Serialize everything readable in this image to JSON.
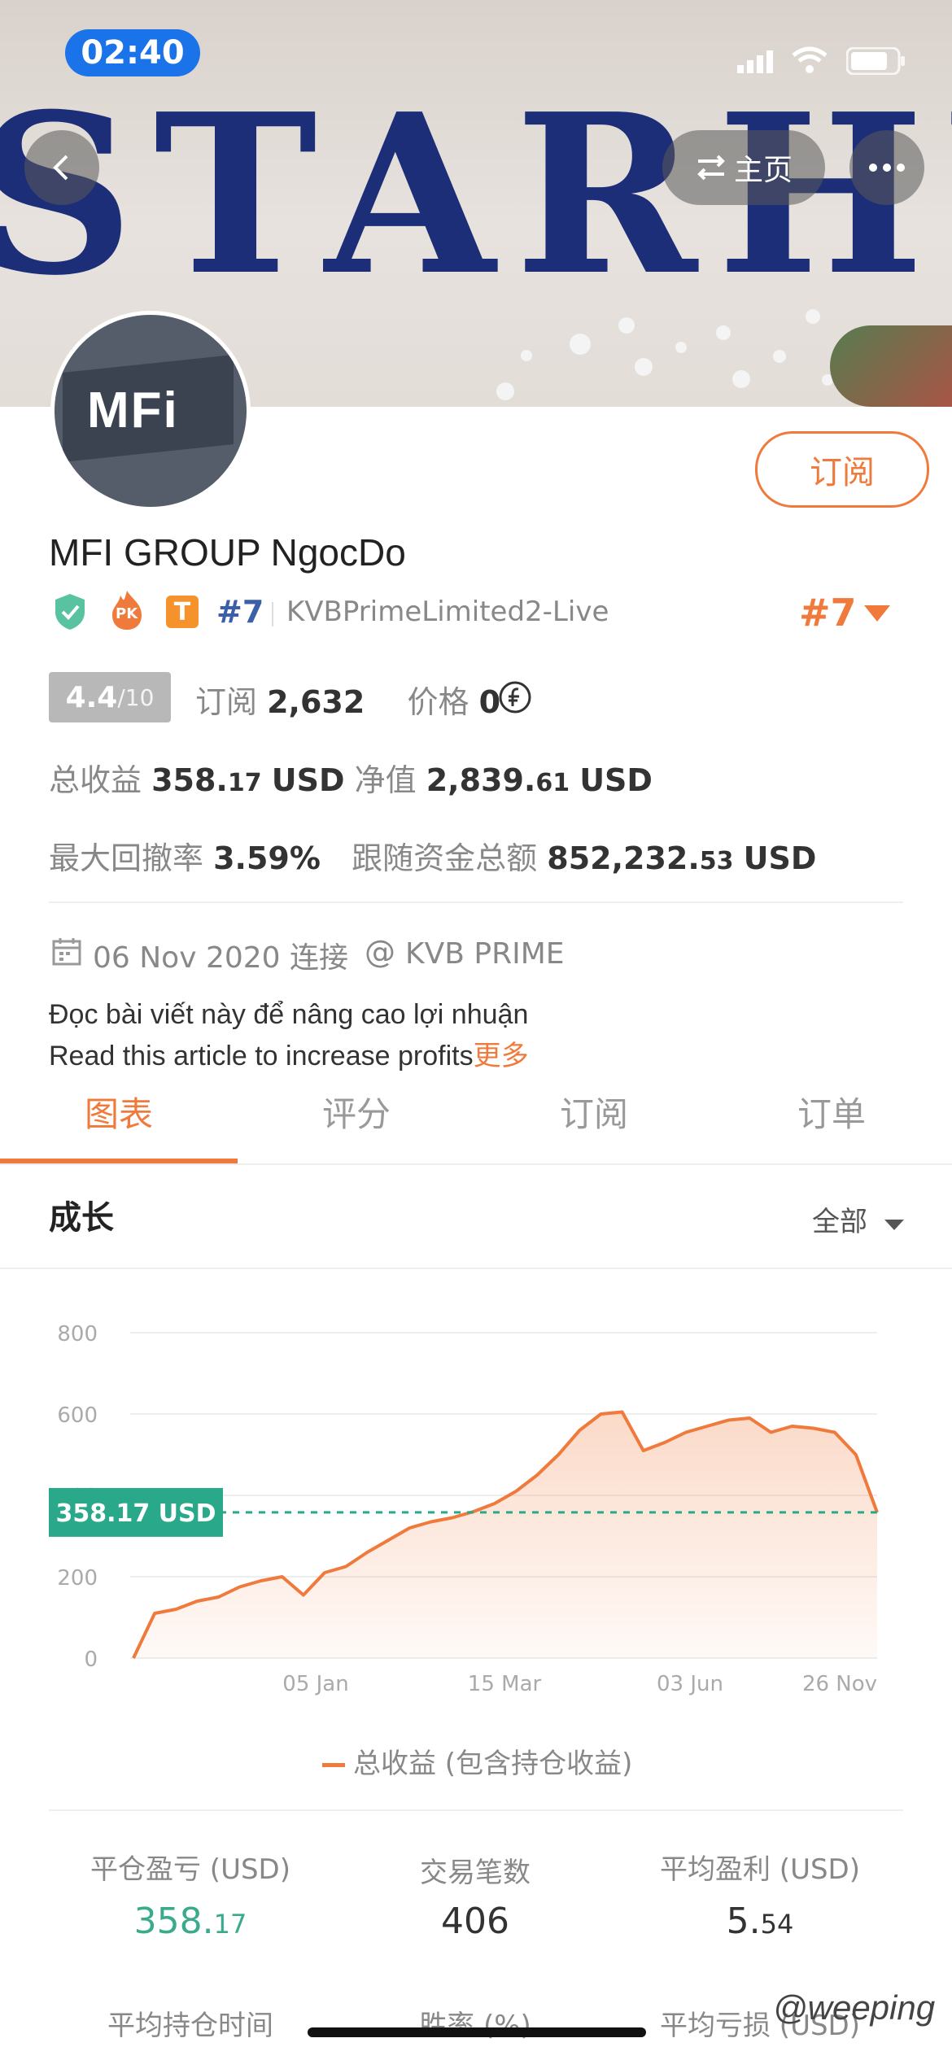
{
  "status_bar": {
    "time": "02:40"
  },
  "header": {
    "banner_text": "STARHU",
    "home_label": "主页"
  },
  "profile": {
    "avatar_logo": "MFi",
    "name": "MFI GROUP NgocDo",
    "subscribe_label": "订阅",
    "badges": {
      "pk": "PK",
      "t": "T"
    },
    "rank_small": "#7",
    "account": "KVBPrimeLimited2-Live",
    "rank_big": "#7",
    "score": "4.4",
    "score_max": "/10",
    "subscribers_label": "订阅",
    "subscribers": "2,632",
    "price_label": "价格",
    "price": "0",
    "total_profit_label": "总收益",
    "total_profit_int": "358.",
    "total_profit_dec": "17",
    "total_profit_unit": "USD",
    "equity_label": "净值",
    "equity_int": "2,839.",
    "equity_dec": "61",
    "equity_unit": "USD",
    "max_drawdown_label": "最大回撤率",
    "max_drawdown": "3.59%",
    "follow_funds_label": "跟随资金总额",
    "follow_funds_int": "852,232.",
    "follow_funds_dec": "53",
    "follow_funds_unit": "USD",
    "connected_date": "06 Nov 2020 连接",
    "broker": "KVB PRIME",
    "desc_line1": "Đọc bài viết này để nâng cao lợi nhuận",
    "desc_line2": "Read this article to increase profits",
    "more_label": "更多"
  },
  "tabs": [
    "图表",
    "评分",
    "订阅",
    "订单"
  ],
  "active_tab": 0,
  "chart_section": {
    "title": "成长",
    "filter": "全部"
  },
  "chart_data": {
    "type": "area",
    "title": "",
    "xlabel": "",
    "ylabel": "",
    "y_ticks": [
      "800",
      "600",
      "400",
      "200",
      "0"
    ],
    "ylim": [
      0,
      800
    ],
    "x_ticks": [
      "05 Jan",
      "15 Mar",
      "03 Jun",
      "26 Nov"
    ],
    "current_value_label": "358.17 USD",
    "current_value": 358.17,
    "legend": "总收益 (包含持仓收益)",
    "series": [
      {
        "name": "总收益 (包含持仓收益)",
        "points": [
          [
            "Nov 06",
            0
          ],
          [
            "Nov 08",
            110
          ],
          [
            "Nov 20",
            120
          ],
          [
            "Dec 01",
            140
          ],
          [
            "Dec 10",
            150
          ],
          [
            "Dec 20",
            175
          ],
          [
            "Dec 30",
            190
          ],
          [
            "Jan 05",
            200
          ],
          [
            "Jan 10",
            155
          ],
          [
            "Jan 15",
            210
          ],
          [
            "Jan 25",
            225
          ],
          [
            "Feb 01",
            260
          ],
          [
            "Feb 10",
            290
          ],
          [
            "Feb 20",
            320
          ],
          [
            "Mar 01",
            335
          ],
          [
            "Mar 10",
            345
          ],
          [
            "Mar 15",
            360
          ],
          [
            "Mar 25",
            380
          ],
          [
            "Apr 05",
            410
          ],
          [
            "Apr 20",
            450
          ],
          [
            "May 05",
            500
          ],
          [
            "May 20",
            560
          ],
          [
            "Jun 01",
            600
          ],
          [
            "Jun 03",
            605
          ],
          [
            "Jun 05",
            510
          ],
          [
            "Jun 20",
            530
          ],
          [
            "Jul 10",
            555
          ],
          [
            "Aug 01",
            570
          ],
          [
            "Aug 20",
            585
          ],
          [
            "Sep 01",
            590
          ],
          [
            "Sep 10",
            555
          ],
          [
            "Oct 01",
            570
          ],
          [
            "Oct 20",
            565
          ],
          [
            "Nov 01",
            555
          ],
          [
            "Nov 15",
            500
          ],
          [
            "Nov 26",
            358
          ]
        ]
      }
    ]
  },
  "stats": [
    {
      "label": "平仓盈亏 (USD)",
      "value_int": "358.",
      "value_dec": "17",
      "color": "#3aaa8c"
    },
    {
      "label": "交易笔数",
      "value_int": "406",
      "value_dec": ""
    },
    {
      "label": "平均盈利 (USD)",
      "value_int": "5.",
      "value_dec": "54"
    }
  ],
  "stats_row2": [
    "平均持仓时间",
    "胜率 (%)",
    "平均亏损 (USD)"
  ],
  "watermark": "@weeping",
  "colors": {
    "accent": "#f07a3c",
    "green": "#2aa98a",
    "rank_blue": "#3b5fa8"
  }
}
